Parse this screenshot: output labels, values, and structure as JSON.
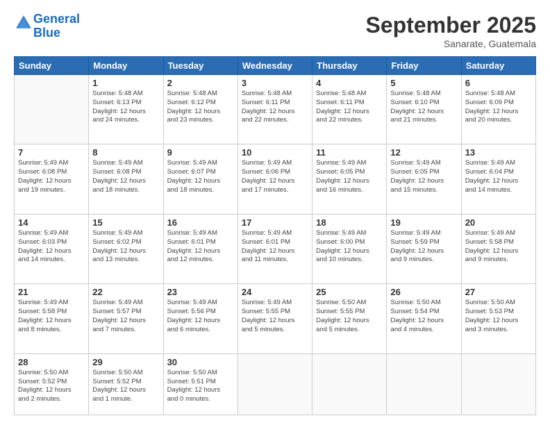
{
  "header": {
    "logo_line1": "General",
    "logo_line2": "Blue",
    "title": "September 2025",
    "location": "Sanarate, Guatemala"
  },
  "weekdays": [
    "Sunday",
    "Monday",
    "Tuesday",
    "Wednesday",
    "Thursday",
    "Friday",
    "Saturday"
  ],
  "weeks": [
    [
      {
        "day": null,
        "info": null
      },
      {
        "day": "1",
        "info": "Sunrise: 5:48 AM\nSunset: 6:13 PM\nDaylight: 12 hours\nand 24 minutes."
      },
      {
        "day": "2",
        "info": "Sunrise: 5:48 AM\nSunset: 6:12 PM\nDaylight: 12 hours\nand 23 minutes."
      },
      {
        "day": "3",
        "info": "Sunrise: 5:48 AM\nSunset: 6:11 PM\nDaylight: 12 hours\nand 22 minutes."
      },
      {
        "day": "4",
        "info": "Sunrise: 5:48 AM\nSunset: 6:11 PM\nDaylight: 12 hours\nand 22 minutes."
      },
      {
        "day": "5",
        "info": "Sunrise: 5:48 AM\nSunset: 6:10 PM\nDaylight: 12 hours\nand 21 minutes."
      },
      {
        "day": "6",
        "info": "Sunrise: 5:48 AM\nSunset: 6:09 PM\nDaylight: 12 hours\nand 20 minutes."
      }
    ],
    [
      {
        "day": "7",
        "info": "Sunrise: 5:49 AM\nSunset: 6:08 PM\nDaylight: 12 hours\nand 19 minutes."
      },
      {
        "day": "8",
        "info": "Sunrise: 5:49 AM\nSunset: 6:08 PM\nDaylight: 12 hours\nand 18 minutes."
      },
      {
        "day": "9",
        "info": "Sunrise: 5:49 AM\nSunset: 6:07 PM\nDaylight: 12 hours\nand 18 minutes."
      },
      {
        "day": "10",
        "info": "Sunrise: 5:49 AM\nSunset: 6:06 PM\nDaylight: 12 hours\nand 17 minutes."
      },
      {
        "day": "11",
        "info": "Sunrise: 5:49 AM\nSunset: 6:05 PM\nDaylight: 12 hours\nand 16 minutes."
      },
      {
        "day": "12",
        "info": "Sunrise: 5:49 AM\nSunset: 6:05 PM\nDaylight: 12 hours\nand 15 minutes."
      },
      {
        "day": "13",
        "info": "Sunrise: 5:49 AM\nSunset: 6:04 PM\nDaylight: 12 hours\nand 14 minutes."
      }
    ],
    [
      {
        "day": "14",
        "info": "Sunrise: 5:49 AM\nSunset: 6:03 PM\nDaylight: 12 hours\nand 14 minutes."
      },
      {
        "day": "15",
        "info": "Sunrise: 5:49 AM\nSunset: 6:02 PM\nDaylight: 12 hours\nand 13 minutes."
      },
      {
        "day": "16",
        "info": "Sunrise: 5:49 AM\nSunset: 6:01 PM\nDaylight: 12 hours\nand 12 minutes."
      },
      {
        "day": "17",
        "info": "Sunrise: 5:49 AM\nSunset: 6:01 PM\nDaylight: 12 hours\nand 11 minutes."
      },
      {
        "day": "18",
        "info": "Sunrise: 5:49 AM\nSunset: 6:00 PM\nDaylight: 12 hours\nand 10 minutes."
      },
      {
        "day": "19",
        "info": "Sunrise: 5:49 AM\nSunset: 5:59 PM\nDaylight: 12 hours\nand 9 minutes."
      },
      {
        "day": "20",
        "info": "Sunrise: 5:49 AM\nSunset: 5:58 PM\nDaylight: 12 hours\nand 9 minutes."
      }
    ],
    [
      {
        "day": "21",
        "info": "Sunrise: 5:49 AM\nSunset: 5:58 PM\nDaylight: 12 hours\nand 8 minutes."
      },
      {
        "day": "22",
        "info": "Sunrise: 5:49 AM\nSunset: 5:57 PM\nDaylight: 12 hours\nand 7 minutes."
      },
      {
        "day": "23",
        "info": "Sunrise: 5:49 AM\nSunset: 5:56 PM\nDaylight: 12 hours\nand 6 minutes."
      },
      {
        "day": "24",
        "info": "Sunrise: 5:49 AM\nSunset: 5:55 PM\nDaylight: 12 hours\nand 5 minutes."
      },
      {
        "day": "25",
        "info": "Sunrise: 5:50 AM\nSunset: 5:55 PM\nDaylight: 12 hours\nand 5 minutes."
      },
      {
        "day": "26",
        "info": "Sunrise: 5:50 AM\nSunset: 5:54 PM\nDaylight: 12 hours\nand 4 minutes."
      },
      {
        "day": "27",
        "info": "Sunrise: 5:50 AM\nSunset: 5:53 PM\nDaylight: 12 hours\nand 3 minutes."
      }
    ],
    [
      {
        "day": "28",
        "info": "Sunrise: 5:50 AM\nSunset: 5:52 PM\nDaylight: 12 hours\nand 2 minutes."
      },
      {
        "day": "29",
        "info": "Sunrise: 5:50 AM\nSunset: 5:52 PM\nDaylight: 12 hours\nand 1 minute."
      },
      {
        "day": "30",
        "info": "Sunrise: 5:50 AM\nSunset: 5:51 PM\nDaylight: 12 hours\nand 0 minutes."
      },
      {
        "day": null,
        "info": null
      },
      {
        "day": null,
        "info": null
      },
      {
        "day": null,
        "info": null
      },
      {
        "day": null,
        "info": null
      }
    ]
  ]
}
